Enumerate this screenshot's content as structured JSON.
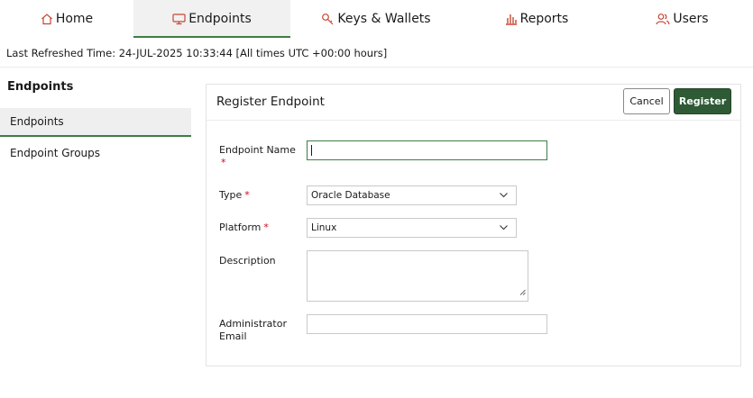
{
  "nav": {
    "tabs": [
      {
        "label": "Home",
        "icon": "home-icon",
        "active": false
      },
      {
        "label": "Endpoints",
        "icon": "monitor-icon",
        "active": true
      },
      {
        "label": "Keys & Wallets",
        "icon": "key-icon",
        "active": false
      },
      {
        "label": "Reports",
        "icon": "bar-chart-icon",
        "active": false
      },
      {
        "label": "Users",
        "icon": "users-icon",
        "active": false
      }
    ]
  },
  "refresh_text": "Last Refreshed Time: 24-JUL-2025 10:33:44 [All times UTC +00:00 hours]",
  "sidebar": {
    "title": "Endpoints",
    "items": [
      {
        "label": "Endpoints",
        "active": true
      },
      {
        "label": "Endpoint Groups",
        "active": false
      }
    ]
  },
  "form": {
    "title": "Register Endpoint",
    "cancel_label": "Cancel",
    "register_label": "Register",
    "required_mark": "*",
    "fields": {
      "name": {
        "label_line1": "Endpoint Name",
        "value": ""
      },
      "type": {
        "label": "Type",
        "value": "Oracle Database"
      },
      "platform": {
        "label": "Platform",
        "value": "Linux"
      },
      "description": {
        "label": "Description",
        "value": ""
      },
      "email": {
        "label_line1": "Administrator",
        "label_line2": "Email",
        "value": ""
      }
    }
  },
  "colors": {
    "accent_green": "#3e7d44",
    "primary_button": "#2f5a36",
    "icon_red": "#c74634",
    "required_red": "#d6001c"
  }
}
